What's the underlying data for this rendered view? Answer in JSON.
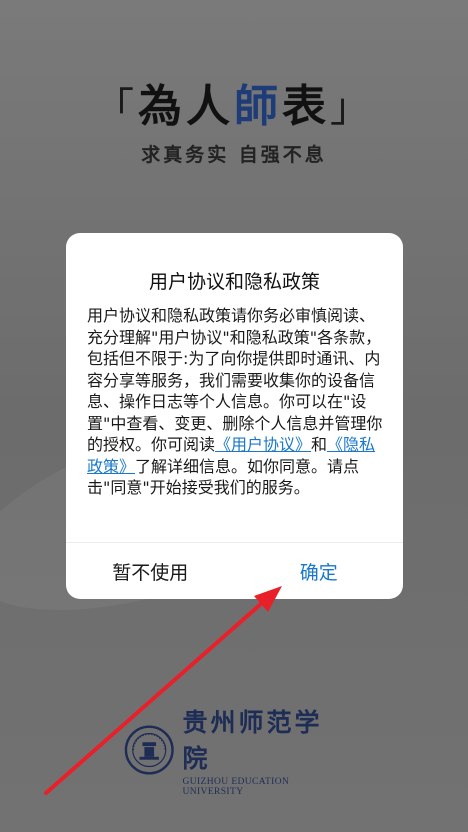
{
  "splash": {
    "slogan_open": "「",
    "slogan_a": "為人",
    "slogan_b": "師",
    "slogan_c": "表",
    "slogan_close": "」",
    "motto": "求真务实  自强不息"
  },
  "dialog": {
    "title": "用户协议和隐私政策",
    "body_1": "用户协议和隐私政策请你务必审慎阅读、充分理解\"用户协议\"和隐私政策\"各条款，包括但不限于:为了向你提供即时通讯、内容分享等服务，我们需要收集你的设备信息、操作日志等个人信息。你可以在\"设置\"中查看、变更、删除个人信息并管理你的授权。你可阅读",
    "link_user_agreement": "《用户协议》",
    "body_and": "和",
    "link_privacy_policy": "《隐私政策》",
    "body_2": "了解详细信息。如你同意。请点击\"同意\"开始接受我们的服务。",
    "cancel_label": "暂不使用",
    "confirm_label": "确定"
  },
  "logo": {
    "name_cn": "贵州师范学院",
    "name_en": "GUIZHOU EDUCATION UNIVERSITY"
  },
  "colors": {
    "accent": "#1a78c8",
    "overlay": "#6f6f6f",
    "arrow": "#e8202a",
    "logo": "#1e2d55"
  }
}
